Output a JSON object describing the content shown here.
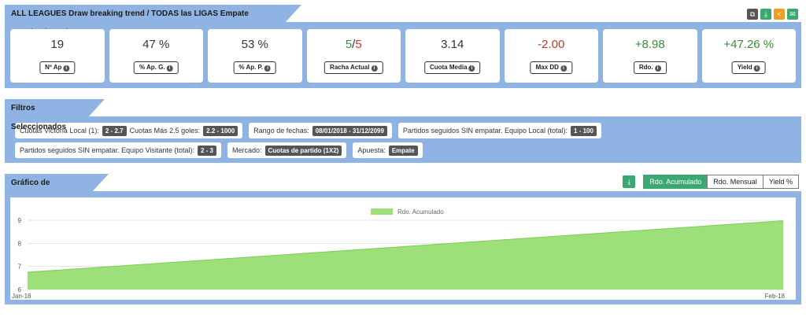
{
  "header": {
    "title": "ALL LEAGUES Draw breaking trend / TODAS las LIGAS Empate rompiendo racha",
    "share_icons": [
      {
        "name": "copy-icon",
        "glyph": "⧉",
        "color": "#555555"
      },
      {
        "name": "download-icon",
        "glyph": "⤓",
        "color": "#3aa870"
      },
      {
        "name": "share-icon",
        "glyph": "<",
        "color": "#f0a020"
      },
      {
        "name": "email-icon",
        "glyph": "✉",
        "color": "#3aa870"
      }
    ]
  },
  "stats": [
    {
      "id": "n-ap",
      "value": "19",
      "label": "Nº Ap"
    },
    {
      "id": "pct-ap-g",
      "value": "47 %",
      "label": "% Ap. G."
    },
    {
      "id": "pct-ap-p",
      "value": "53 %",
      "label": "% Ap. P."
    },
    {
      "id": "racha-actual",
      "value_a": "5",
      "value_sep": "/",
      "value_b": "5",
      "label": "Racha Actual",
      "color_a": "#3a8a3a",
      "color_b": "#c0392b"
    },
    {
      "id": "cuota-media",
      "value": "3.14",
      "label": "Cuota Media"
    },
    {
      "id": "max-dd",
      "value": "-2.00",
      "label": "Max DD",
      "color": "#c0392b"
    },
    {
      "id": "rdo",
      "value": "+8.98",
      "label": "Rdo.",
      "color": "#3a8a3a"
    },
    {
      "id": "yield",
      "value": "+47.26 %",
      "label": "Yield",
      "color": "#3a8a3a"
    }
  ],
  "filters": {
    "title": "Filtros Seleccionados",
    "row1": {
      "f1": {
        "text_a": "Cuotas Victoria Local (1):",
        "badge_a": "2 - 2.7",
        "text_b": "Cuotas Más 2.5 goles:",
        "badge_b": "2.2 - 1000"
      },
      "f2": {
        "text": "Rango de fechas:",
        "badge": "08/01/2018 - 31/12/2099"
      },
      "f3": {
        "text": "Partidos seguidos SIN empatar. Equipo Local (total):",
        "badge": "1 - 100"
      }
    },
    "row2": {
      "f1": {
        "text": "Partidos seguidos SIN empatar. Equipo Visitante (total):",
        "badge": "2 - 3"
      },
      "f2": {
        "text": "Mercado:",
        "badge": "Cuotas de partido (1X2)"
      },
      "f3": {
        "text": "Apuesta:",
        "badge": "Empate"
      }
    }
  },
  "chart_section": {
    "title": "Gráfico de Resultados",
    "download_icon": "download-icon",
    "tabs": [
      {
        "label": "Rdo. Acumulado",
        "active": true
      },
      {
        "label": "Rdo. Mensual",
        "active": false
      },
      {
        "label": "Yield %",
        "active": false
      }
    ]
  },
  "chart_data": {
    "type": "area",
    "x": [
      "Jan-18",
      "Feb-18"
    ],
    "series": [
      {
        "name": "Rdo. Acumulado",
        "values": [
          6.75,
          8.98
        ],
        "color": "#9de07a"
      }
    ],
    "ylim": [
      6,
      9
    ],
    "yticks": [
      6,
      7,
      8,
      9
    ],
    "grid": true,
    "legend": "top-center"
  }
}
